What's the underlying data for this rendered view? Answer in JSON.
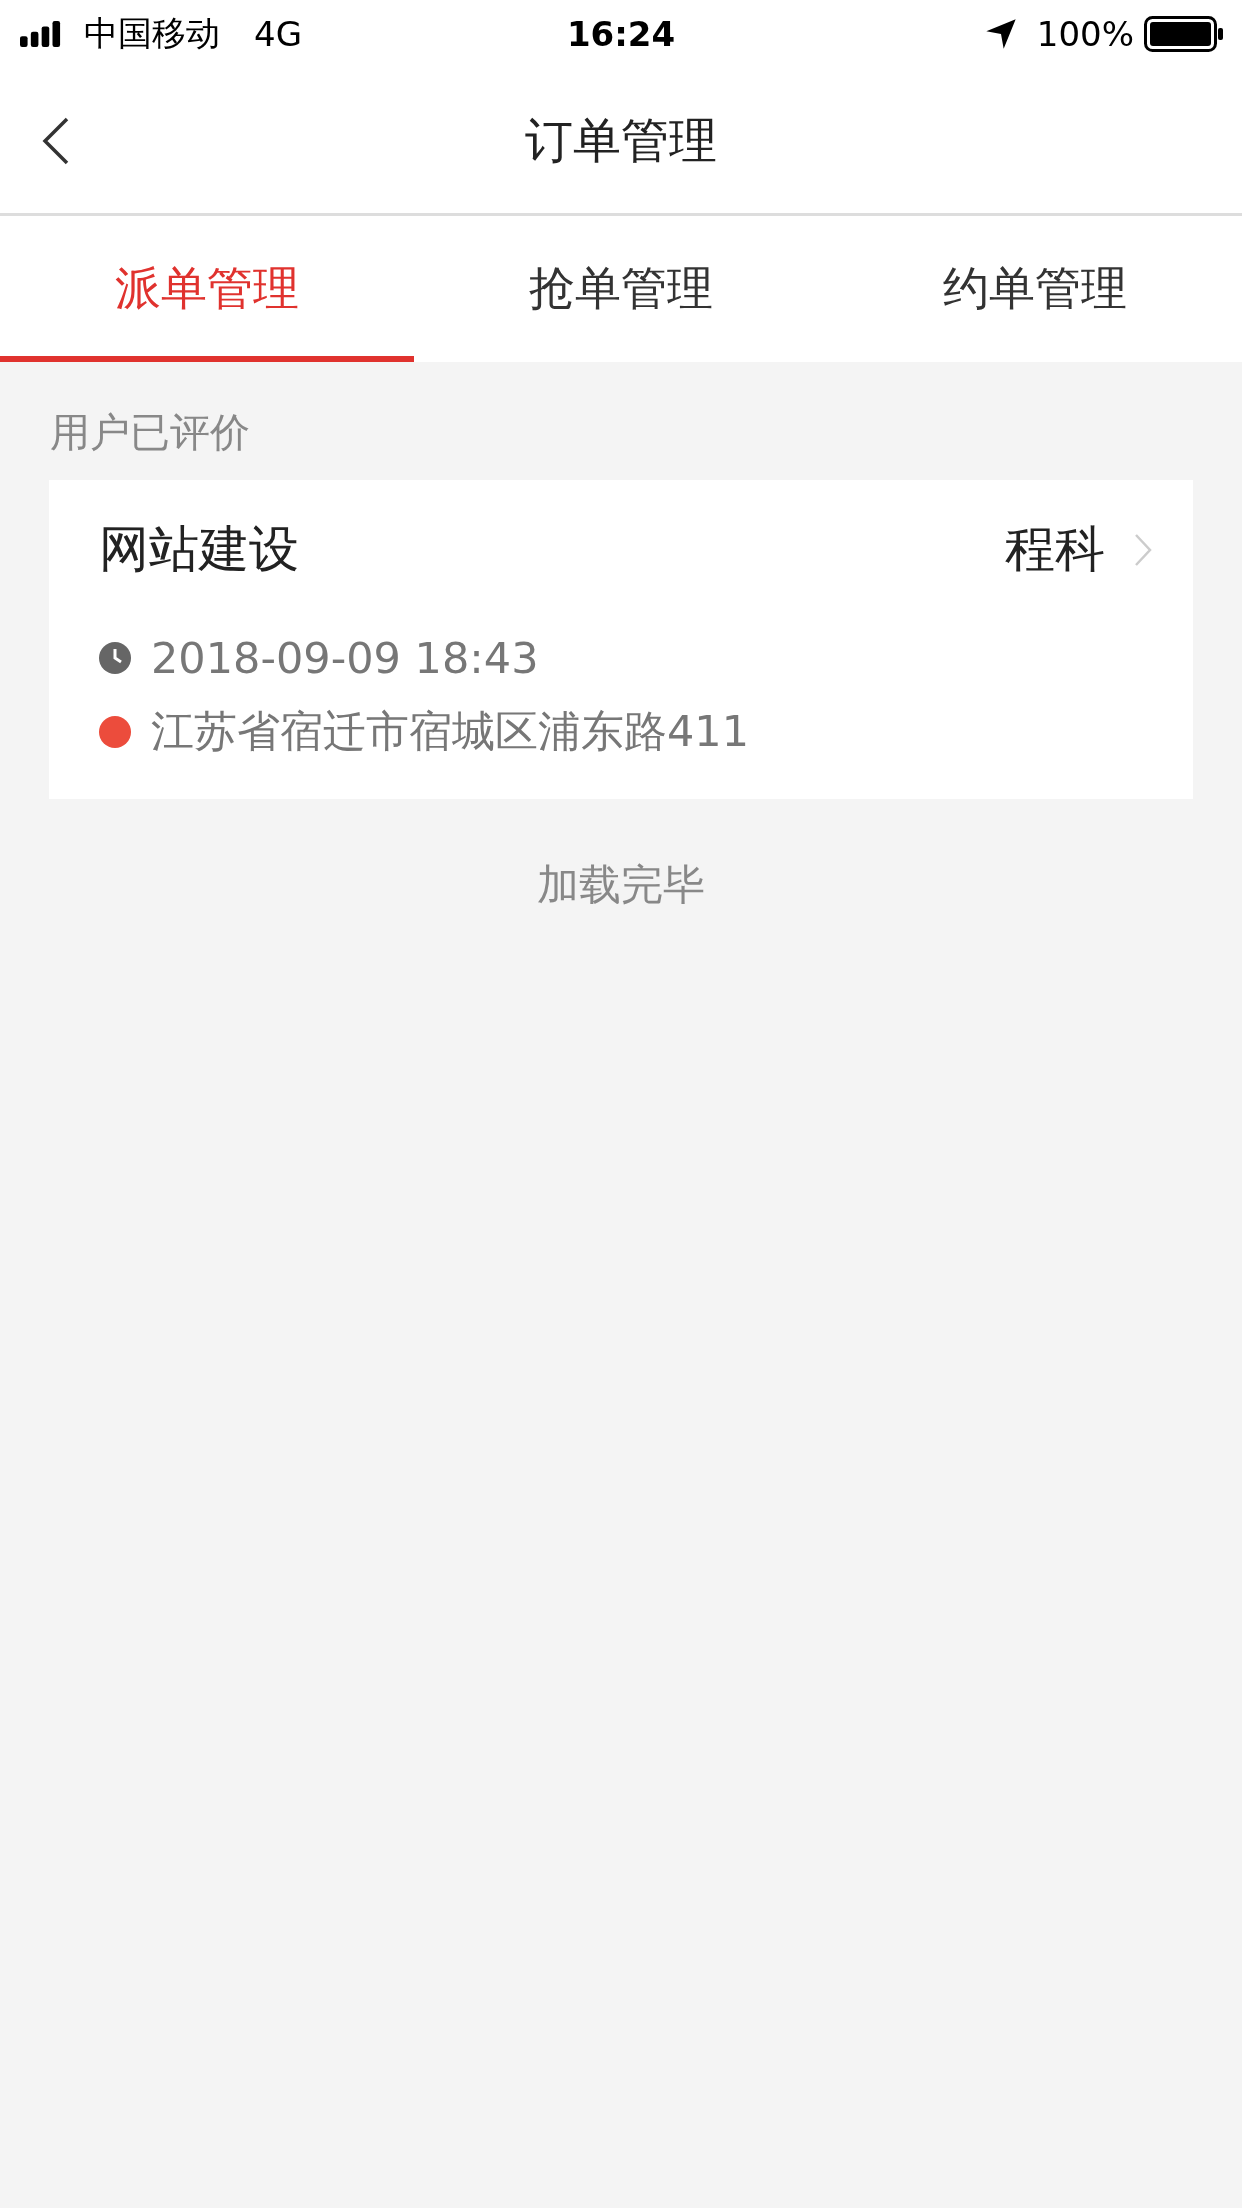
{
  "status_bar": {
    "carrier": "中国移动",
    "network": "4G",
    "time": "16:24",
    "battery": "100%"
  },
  "nav": {
    "title": "订单管理"
  },
  "tabs": [
    {
      "label": "派单管理",
      "selected": true
    },
    {
      "label": "抢单管理",
      "selected": false
    },
    {
      "label": "约单管理",
      "selected": false
    }
  ],
  "section_label": "用户已评价",
  "orders": [
    {
      "title": "网站建设",
      "customer": "程科",
      "time": "2018-09-09 18:43",
      "address": "江苏省宿迁市宿城区浦东路411"
    }
  ],
  "footer": "加载完毕"
}
